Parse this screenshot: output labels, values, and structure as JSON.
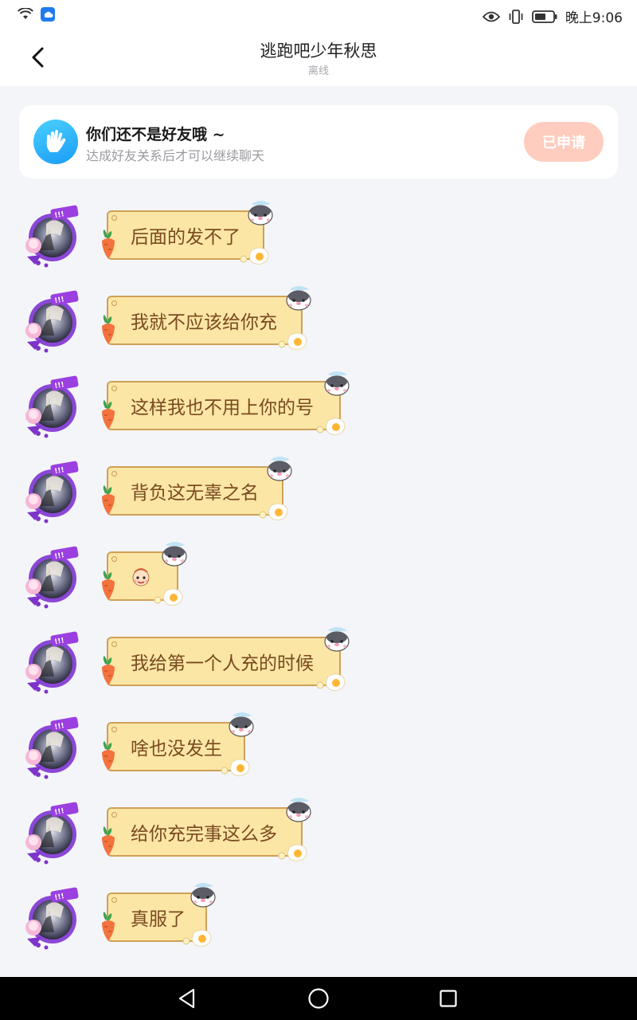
{
  "status_bar": {
    "time": "晚上9:06"
  },
  "header": {
    "title": "逃跑吧少年秋思",
    "status": "离线"
  },
  "friend_notice": {
    "title": "你们还不是好友哦 ~",
    "description": "达成好友关系后才可以继续聊天",
    "button_label": "已申请"
  },
  "messages": [
    {
      "text": "后面的发不了",
      "type": "text"
    },
    {
      "text": "我就不应该给你充",
      "type": "text"
    },
    {
      "text": "这样我也不用上你的号",
      "type": "text"
    },
    {
      "text": "背负这无辜之名",
      "type": "text"
    },
    {
      "text": "",
      "type": "emoji",
      "emoji": "cute-face-emoji"
    },
    {
      "text": "我给第一个人充的时候",
      "type": "text"
    },
    {
      "text": "啥也没发生",
      "type": "text"
    },
    {
      "text": "给你充完事这么多",
      "type": "text"
    },
    {
      "text": "真服了",
      "type": "text"
    }
  ],
  "colors": {
    "bubble_fill": "#fbe6a6",
    "bubble_border": "#cfa057",
    "bubble_text": "#7a4a1f",
    "applied_button": "#ffcdbf",
    "accent_blue": "#1b9cf5"
  },
  "icons": {
    "back": "chevron-left-icon",
    "nav_back": "triangle-back-icon",
    "nav_home": "circle-home-icon",
    "nav_recent": "square-recent-icon"
  }
}
